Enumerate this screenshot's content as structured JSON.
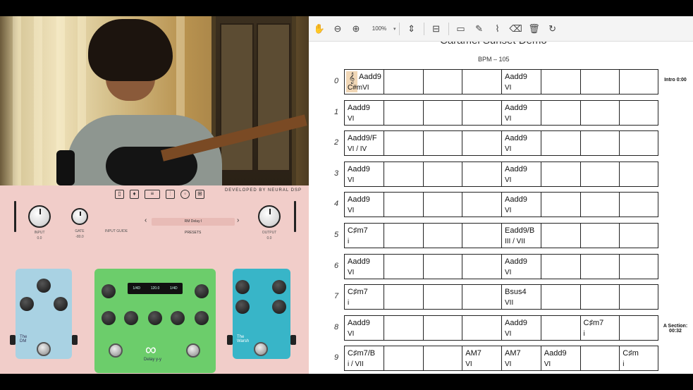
{
  "plugin": {
    "developer": "DEVELOPED BY NEURAL DSP",
    "controls": {
      "input_label": "INPUT",
      "input_value": "0.0",
      "gate_label": "GATE",
      "gate_value": "-80.0",
      "output_label": "OUTPUT",
      "output_value": "0.0",
      "gate_mode": "INPUT GUIDE"
    },
    "preset_name": "RM Delay I",
    "presets_label": "PRESETS",
    "pedals": {
      "left_name": "The\nDM",
      "middle_name": "Delay y-y",
      "right_name": "The\nWarsh"
    }
  },
  "pdf": {
    "toolbar": {
      "zoom": "100%"
    },
    "title": "Caramel Sunset Demo",
    "bpm": "BPM – 105",
    "rows": [
      {
        "num": "0",
        "section": "Intro 0:00",
        "cells": [
          {
            "chord": "Aadd9",
            "roman": "C#mVI",
            "clef": true
          },
          {},
          {},
          {},
          {
            "chord": "Aadd9",
            "roman": "VI"
          },
          {},
          {},
          {}
        ]
      },
      {
        "num": "1",
        "section": "",
        "cells": [
          {
            "chord": "Aadd9",
            "roman": "VI"
          },
          {},
          {},
          {},
          {
            "chord": "Aadd9",
            "roman": "VI"
          },
          {},
          {},
          {}
        ]
      },
      {
        "num": "2",
        "section": "",
        "cells": [
          {
            "chord": "Aadd9/F",
            "roman": "VI / IV"
          },
          {},
          {},
          {},
          {
            "chord": "Aadd9",
            "roman": "VI"
          },
          {},
          {},
          {}
        ]
      },
      {
        "num": "3",
        "section": "",
        "cells": [
          {
            "chord": "Aadd9",
            "roman": "VI"
          },
          {},
          {},
          {},
          {
            "chord": "Aadd9",
            "roman": "VI"
          },
          {},
          {},
          {}
        ]
      },
      {
        "num": "4",
        "section": "",
        "cells": [
          {
            "chord": "Aadd9",
            "roman": "VI"
          },
          {},
          {},
          {},
          {
            "chord": "Aadd9",
            "roman": "VI"
          },
          {},
          {},
          {}
        ]
      },
      {
        "num": "5",
        "section": "",
        "cells": [
          {
            "chord": "C♯m7",
            "roman": "i"
          },
          {},
          {},
          {},
          {
            "chord": "Eadd9/B",
            "roman": "III / VII"
          },
          {},
          {},
          {}
        ]
      },
      {
        "num": "6",
        "section": "",
        "cells": [
          {
            "chord": "Aadd9",
            "roman": "VI"
          },
          {},
          {},
          {},
          {
            "chord": "Aadd9",
            "roman": "VI"
          },
          {},
          {},
          {}
        ]
      },
      {
        "num": "7",
        "section": "",
        "cells": [
          {
            "chord": "C♯m7",
            "roman": "i"
          },
          {},
          {},
          {},
          {
            "chord": "Bsus4",
            "roman": "VII"
          },
          {},
          {},
          {}
        ]
      },
      {
        "num": "8",
        "section": "A Section: 00:32",
        "cells": [
          {
            "chord": "Aadd9",
            "roman": "VI"
          },
          {},
          {},
          {},
          {
            "chord": "Aadd9",
            "roman": "VI"
          },
          {},
          {
            "chord": "C♯m7",
            "roman": "i"
          },
          {}
        ]
      },
      {
        "num": "9",
        "section": "",
        "cells": [
          {
            "chord": "C♯m7/B",
            "roman": "i / VII"
          },
          {},
          {},
          {
            "chord": "AM7",
            "roman": "VI"
          },
          {
            "chord": "AM7",
            "roman": "VI"
          },
          {
            "chord": "Aadd9",
            "roman": "VI"
          },
          {},
          {
            "chord": "C♯m",
            "roman": "i"
          }
        ]
      }
    ]
  }
}
